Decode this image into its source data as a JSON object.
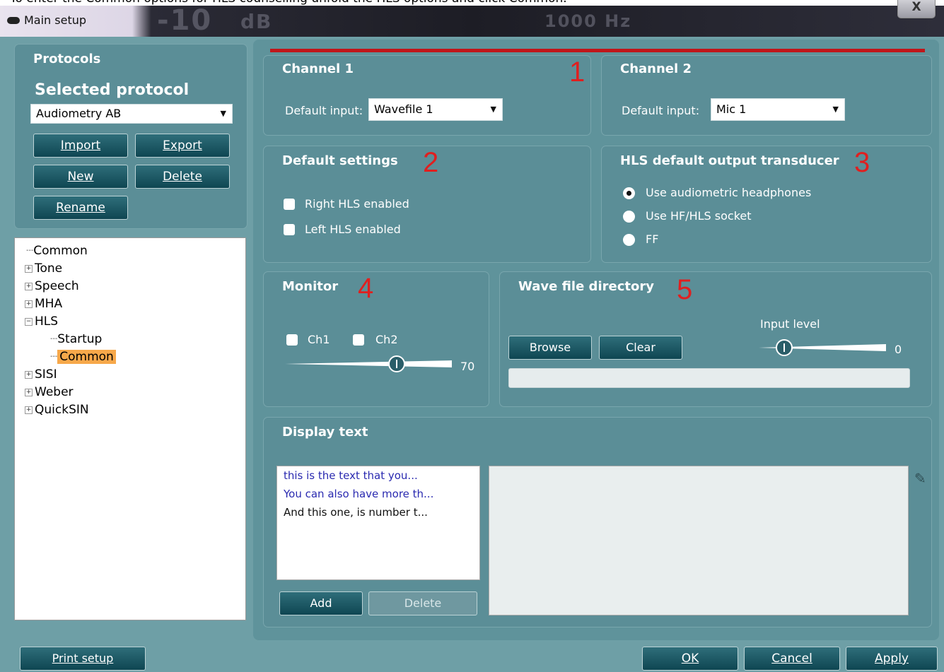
{
  "window": {
    "title": "Main setup",
    "caption_above": "To enter the Common options for HLS counselling unfold the HLS options and click Common.",
    "close_label": "X",
    "ghost_texts": [
      "-10",
      "dB",
      "1000 Hz"
    ]
  },
  "protocols": {
    "heading": "Protocols",
    "selected_heading": "Selected protocol",
    "selected_value": "Audiometry AB",
    "buttons": {
      "import": "Import",
      "export": "Export",
      "new": "New",
      "delete": "Delete",
      "rename": "Rename"
    }
  },
  "tree": {
    "items": [
      "Common",
      "Tone",
      "Speech",
      "MHA",
      "HLS",
      "Startup",
      "Common",
      "SISI",
      "Weber",
      "QuickSIN"
    ],
    "selected": "Common"
  },
  "channel1": {
    "title": "Channel 1",
    "label": "Default input:",
    "value": "Wavefile 1",
    "marker": "1"
  },
  "channel2": {
    "title": "Channel 2",
    "label": "Default input:",
    "value": "Mic 1"
  },
  "default_settings": {
    "title": "Default settings",
    "marker": "2",
    "right_hls": "Right HLS enabled",
    "left_hls": "Left HLS enabled"
  },
  "transducer": {
    "title": "HLS default output transducer",
    "marker": "3",
    "options": [
      "Use audiometric headphones",
      "Use HF/HLS socket",
      "FF"
    ],
    "selected": 0
  },
  "monitor": {
    "title": "Monitor",
    "marker": "4",
    "ch1": "Ch1",
    "ch2": "Ch2",
    "level": "70"
  },
  "wave": {
    "title": "Wave file directory",
    "marker": "5",
    "browse": "Browse",
    "clear": "Clear",
    "input_level_label": "Input level",
    "input_level": "0"
  },
  "display_text": {
    "title": "Display text",
    "entries": [
      "this is the text that you...",
      "You can also have more th...",
      "And this one, is number t..."
    ],
    "add": "Add",
    "delete": "Delete"
  },
  "footer": {
    "print_setup": "Print setup",
    "ok": "OK",
    "cancel": "Cancel",
    "apply": "Apply"
  },
  "colors": {
    "background": "#6e9fa6",
    "panel": "#5b8e97",
    "button": "#1f5a66",
    "marker": "#e01f1f",
    "tree_selected": "#f7a84a"
  }
}
